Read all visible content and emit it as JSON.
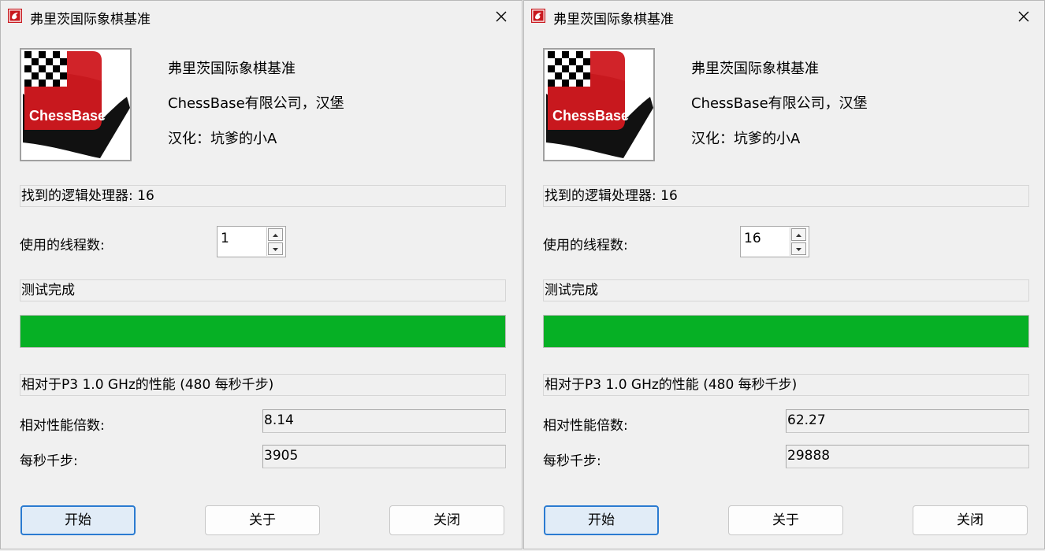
{
  "windows": [
    {
      "title": "弗里茨国际象棋基准",
      "info": {
        "product": "弗里茨国际象棋基准",
        "company": "ChessBase有限公司，汉堡",
        "localization": "汉化：坑爹的小A"
      },
      "logo_text": "ChessBase",
      "processors_text": "找到的逻辑处理器: 16",
      "threads_label": "使用的线程数:",
      "threads_value": "1",
      "status_text": "测试完成",
      "progress_percent": 100,
      "perf_header": "相对于P3 1.0 GHz的性能 (480 每秒千步)",
      "relative_label": "相对性能倍数:",
      "relative_value": "8.14",
      "kns_label": "每秒千步:",
      "kns_value": "3905",
      "buttons": {
        "start": "开始",
        "about": "关于",
        "close": "关闭"
      }
    },
    {
      "title": "弗里茨国际象棋基准",
      "info": {
        "product": "弗里茨国际象棋基准",
        "company": "ChessBase有限公司，汉堡",
        "localization": "汉化：坑爹的小A"
      },
      "logo_text": "ChessBase",
      "processors_text": "找到的逻辑处理器: 16",
      "threads_label": "使用的线程数:",
      "threads_value": "16",
      "status_text": "测试完成",
      "progress_percent": 100,
      "perf_header": "相对于P3 1.0 GHz的性能 (480 每秒千步)",
      "relative_label": "相对性能倍数:",
      "relative_value": "62.27",
      "kns_label": "每秒千步:",
      "kns_value": "29888",
      "buttons": {
        "start": "开始",
        "about": "关于",
        "close": "关闭"
      }
    }
  ],
  "colors": {
    "progress": "#06b025",
    "logo_red": "#c8181e",
    "default_button_border": "#2b7bd1",
    "default_button_bg": "#e1ecf7"
  },
  "icons": {
    "title": "chessbase-app-icon",
    "close": "close-icon",
    "spin_up": "spin-up-arrow-icon",
    "spin_down": "spin-down-arrow-icon"
  }
}
